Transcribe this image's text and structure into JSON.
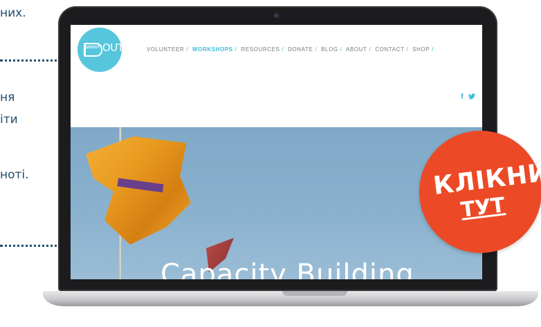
{
  "side": {
    "l1": "них.",
    "l2": "ня",
    "l3": "іти",
    "l4": "ноті."
  },
  "site": {
    "logo": {
      "shout": "SHOUT",
      "out": "OUT"
    },
    "nav": [
      "VOLUNTEER",
      "WORKSHOPS",
      "RESOURCES",
      "DONATE",
      "BLOG",
      "ABOUT",
      "CONTACT",
      "SHOP"
    ],
    "nav_active_index": 1,
    "social": {
      "facebook": "f",
      "twitter": "𝕥"
    },
    "hero_title": "Capacity Building"
  },
  "cta": {
    "line1": "КЛІКНИ",
    "line2": "ТУТ"
  },
  "colors": {
    "accent": "#38bcd6",
    "logo": "#56c6dc",
    "cta": "#ec4a27",
    "side_text": "#1f4e6e"
  }
}
